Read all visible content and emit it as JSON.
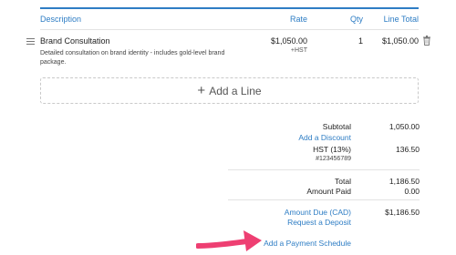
{
  "header": {
    "description": "Description",
    "rate": "Rate",
    "qty": "Qty",
    "line_total": "Line Total"
  },
  "line_item": {
    "name": "Brand Consultation",
    "description": "Detailed consultation on brand identity - includes gold-level brand package.",
    "rate": "$1,050.00",
    "tax": "+HST",
    "qty": "1",
    "total": "$1,050.00"
  },
  "add_line_label": "Add a Line",
  "summary": {
    "subtotal_label": "Subtotal",
    "subtotal_value": "1,050.00",
    "add_discount": "Add a Discount",
    "hst_label": "HST (13%)",
    "hst_number": "#123456789",
    "hst_value": "136.50",
    "total_label": "Total",
    "total_value": "1,186.50",
    "amount_paid_label": "Amount Paid",
    "amount_paid_value": "0.00",
    "amount_due_label": "Amount Due (CAD)",
    "amount_due_value": "$1,186.50",
    "request_deposit": "Request a Deposit",
    "add_payment_schedule": "Add a Payment Schedule"
  },
  "colors": {
    "accent_blue": "#2e7dc4",
    "annotation_pink": "#ee3f72"
  },
  "icons": {
    "drag": "drag-handle-icon",
    "trash": "trash-icon",
    "plus": "plus-icon",
    "arrow": "annotation-arrow"
  }
}
